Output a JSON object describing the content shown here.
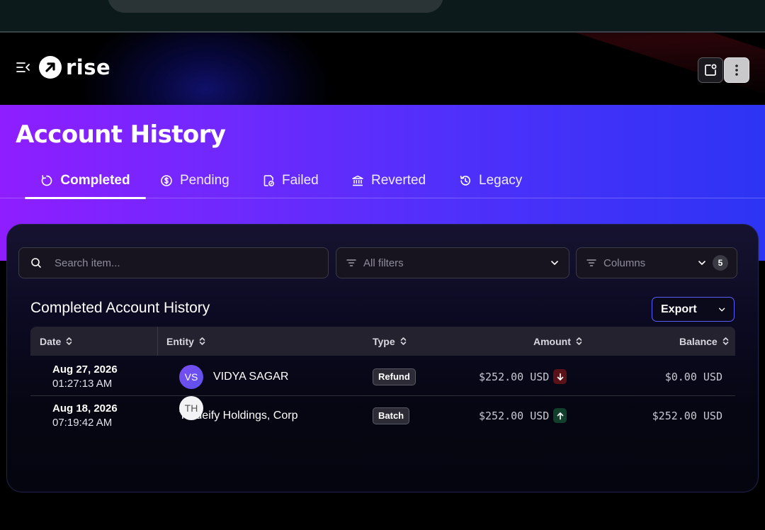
{
  "app": {
    "brand": "rise",
    "icons": [
      "menu-collapse-icon",
      "rise-logo-icon",
      "notification-icon",
      "more-vertical-icon"
    ]
  },
  "page": {
    "title": "Account History"
  },
  "tabs": [
    {
      "label": "Completed",
      "icon": "refresh-icon",
      "active": true
    },
    {
      "label": "Pending",
      "icon": "dollar-circle-icon",
      "active": false
    },
    {
      "label": "Failed",
      "icon": "document-error-icon",
      "active": false
    },
    {
      "label": "Reverted",
      "icon": "bank-icon",
      "active": false
    },
    {
      "label": "Legacy",
      "icon": "history-icon",
      "active": false
    }
  ],
  "toolbar": {
    "search_placeholder": "Search item...",
    "filters_label": "All filters",
    "columns_label": "Columns",
    "columns_count": "5"
  },
  "section": {
    "title": "Completed Account History",
    "export_label": "Export"
  },
  "table": {
    "columns": [
      "Date",
      "Entity",
      "Type",
      "Amount",
      "Balance"
    ],
    "rows": [
      {
        "date": "Aug 27, 2026",
        "time": "01:27:13 AM",
        "initials": "VS",
        "entity": "VIDYA SAGAR",
        "type": "Refund",
        "amount": "$252.00 USD",
        "direction": "down",
        "balance": "$0.00 USD"
      },
      {
        "date": "Aug 18, 2026",
        "time": "07:19:42 AM",
        "initials": "TH",
        "entity": "Tradeify Holdings, Corp",
        "type": "Batch",
        "amount": "$252.00 USD",
        "direction": "up",
        "balance": "$252.00 USD"
      }
    ]
  },
  "colors": {
    "banner_start": "#8e1eff",
    "banner_end": "#2d34f4",
    "export_border": "#5b5dff",
    "debit": "#5a1218",
    "credit": "#10402c"
  }
}
